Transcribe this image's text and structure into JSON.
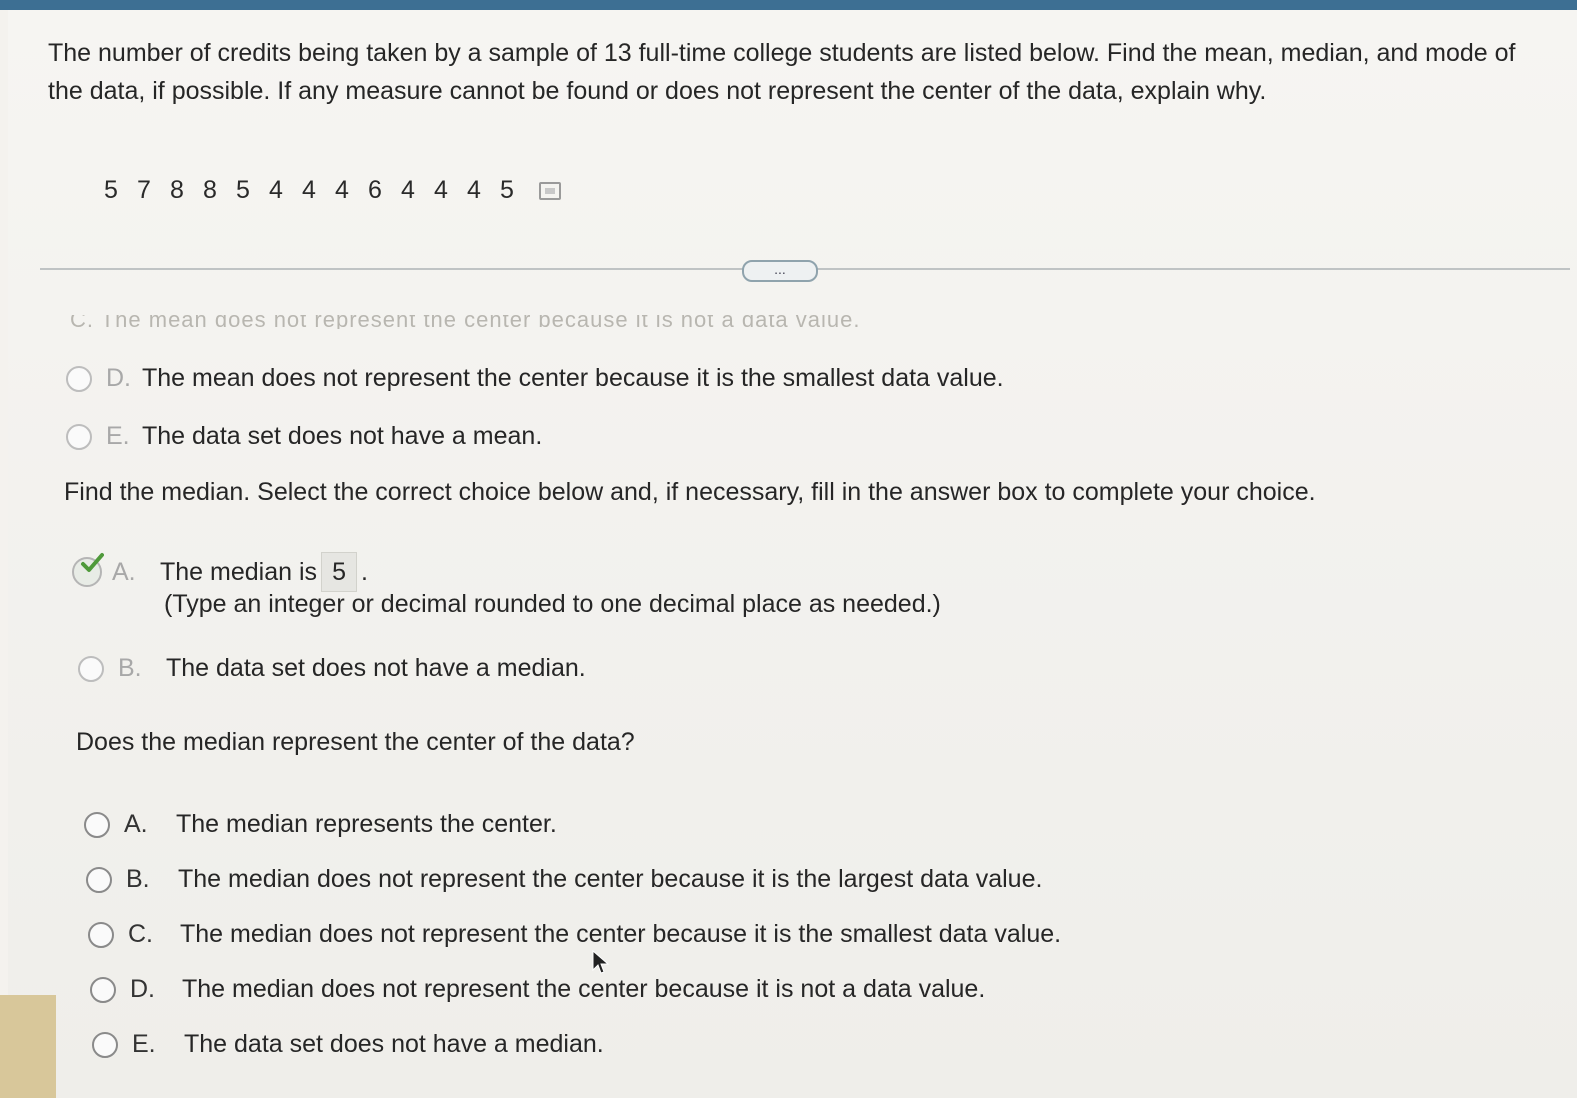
{
  "question": {
    "text": "The number of credits being taken by a sample of 13 full-time college students are listed below. Find the mean, median, and mode of the data, if possible. If any measure cannot be found or does not represent the center of the data, explain why."
  },
  "data_values": [
    "5",
    "7",
    "8",
    "8",
    "5",
    "4",
    "4",
    "4",
    "6",
    "4",
    "4",
    "4",
    "5"
  ],
  "more_button_label": "...",
  "faded_text": "C. The mean does not represent the center because it is not a data value.",
  "mean_choices": [
    {
      "letter": "D.",
      "text": "The mean does not represent the center because it is the smallest data value."
    },
    {
      "letter": "E.",
      "text": "The data set does not have a mean."
    }
  ],
  "median_prompt": "Find the median. Select the correct choice below and, if necessary, fill in the answer box to complete your choice.",
  "median_choice_a": {
    "letter": "A.",
    "prefix": "The median is",
    "answer": "5",
    "suffix": ".",
    "hint": "(Type an integer or decimal rounded to one decimal place as needed.)"
  },
  "median_choice_b": {
    "letter": "B.",
    "text": "The data set does not have a median."
  },
  "center_prompt": "Does the median represent the center of the data?",
  "center_choices": [
    {
      "letter": "A.",
      "text": "The median represents the center."
    },
    {
      "letter": "B.",
      "text": "The median does not represent the center because it is the largest data value."
    },
    {
      "letter": "C.",
      "text": "The median does not represent the center because it is the smallest data value."
    },
    {
      "letter": "D.",
      "text": "The median does not represent the center because it is not a data value."
    },
    {
      "letter": "E.",
      "text": "The data set does not have a median."
    }
  ],
  "colors": {
    "top_bar": "#3d6f93",
    "check": "#4f9a3b"
  }
}
